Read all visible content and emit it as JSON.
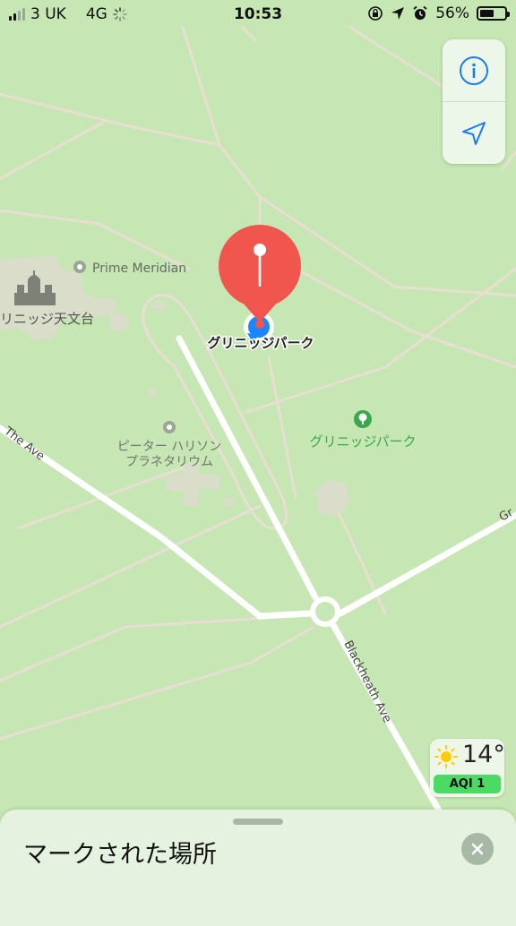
{
  "status_bar": {
    "carrier": "3 UK",
    "network": "4G",
    "time": "10:53",
    "battery_percent": "56%",
    "battery_level": 0.56
  },
  "map": {
    "labels": {
      "prime_meridian": "Prime Meridian",
      "observatory": "リニッジ天文台",
      "dropped_pin_place": "グリニッジパーク",
      "planetarium_line1": "ピーター ハリソン",
      "planetarium_line2": "プラネタリウム",
      "park_poi": "グリニッジパーク",
      "the_ave": "The Ave",
      "blackheath_ave": "Blackheath Ave",
      "road_edge": "Gr"
    }
  },
  "controls": {
    "info_icon": "info-icon",
    "location_icon": "location-arrow-icon"
  },
  "weather": {
    "temperature": "14°",
    "aqi": "AQI 1",
    "icon": "sun-icon"
  },
  "bottom_sheet": {
    "title": "マークされた場所",
    "close_icon": "close-icon"
  },
  "colors": {
    "map_bg": "#c6e6b3",
    "road": "#ffffff",
    "path": "#e8dfd2",
    "pin": "#f0554e",
    "user_location": "#1a86ff",
    "poi_green": "#3aa84a",
    "accent_blue": "#1a7cf5",
    "aqi_green": "#4cd964"
  }
}
